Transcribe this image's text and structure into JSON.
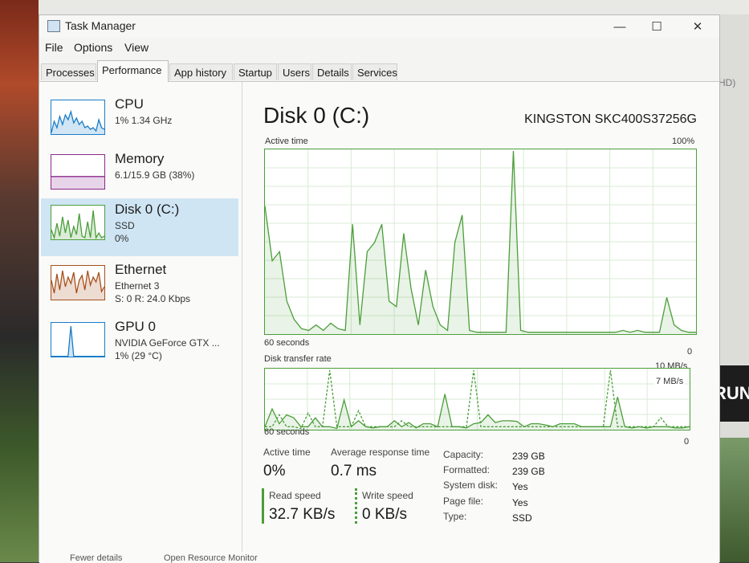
{
  "window": {
    "title": "Task Manager",
    "controls": {
      "minimize": "—",
      "maximize": "☐",
      "close": "✕"
    }
  },
  "menu": [
    "File",
    "Options",
    "View"
  ],
  "tabs": [
    {
      "label": "Processes",
      "active": false
    },
    {
      "label": "Performance",
      "active": true
    },
    {
      "label": "App history",
      "active": false
    },
    {
      "label": "Startup",
      "active": false
    },
    {
      "label": "Users",
      "active": false
    },
    {
      "label": "Details",
      "active": false
    },
    {
      "label": "Services",
      "active": false
    }
  ],
  "sidebar": [
    {
      "name": "CPU",
      "lines": [
        "1% 1.34 GHz"
      ],
      "color": "#1a7cc8",
      "selected": false,
      "spark": [
        5,
        40,
        20,
        55,
        30,
        60,
        45,
        70,
        35,
        50,
        30,
        40,
        20,
        25,
        15,
        20,
        10,
        45,
        20,
        15
      ]
    },
    {
      "name": "Memory",
      "lines": [
        "6.1/15.9 GB (38%)"
      ],
      "color": "#8b2a8b",
      "selected": false,
      "spark": [
        38,
        38,
        38,
        38,
        38,
        38,
        38,
        38,
        38,
        38,
        38,
        38,
        38,
        38,
        38,
        38,
        38,
        38,
        38,
        38
      ]
    },
    {
      "name": "Disk 0 (C:)",
      "lines": [
        "SSD",
        "0%"
      ],
      "color": "#4b9e3a",
      "selected": true,
      "spark": [
        30,
        5,
        50,
        10,
        70,
        20,
        60,
        5,
        40,
        15,
        80,
        10,
        5,
        55,
        5,
        90,
        5,
        20,
        5,
        10
      ]
    },
    {
      "name": "Ethernet",
      "lines": [
        "Ethernet 3",
        "S: 0 R: 24.0 Kbps"
      ],
      "color": "#a7501c",
      "selected": false,
      "spark": [
        60,
        20,
        80,
        30,
        90,
        40,
        70,
        50,
        85,
        20,
        60,
        75,
        30,
        90,
        45,
        70,
        55,
        85,
        25,
        40
      ]
    },
    {
      "name": "GPU 0",
      "lines": [
        "NVIDIA GeForce GTX ...",
        "1% (29 °C)"
      ],
      "color": "#1a7cc8",
      "selected": false,
      "spark": [
        1,
        1,
        1,
        1,
        1,
        1,
        1,
        95,
        1,
        1,
        1,
        1,
        1,
        1,
        1,
        1,
        1,
        1,
        1,
        1
      ]
    }
  ],
  "detail": {
    "title": "Disk 0 (C:)",
    "model": "KINGSTON SKC400S37256G",
    "active_time_graph": {
      "label": "Active time",
      "max_label": "100%",
      "time_label": "60 seconds",
      "min_label": "0",
      "series_color": "#4b9e3a",
      "values": [
        70,
        40,
        45,
        18,
        8,
        3,
        2,
        5,
        2,
        6,
        3,
        2,
        60,
        5,
        45,
        50,
        60,
        18,
        15,
        55,
        25,
        5,
        35,
        15,
        5,
        2,
        50,
        65,
        2,
        1,
        1,
        1,
        1,
        1,
        100,
        2,
        1,
        1,
        1,
        1,
        1,
        1,
        1,
        1,
        1,
        1,
        1,
        1,
        1,
        2,
        1,
        2,
        1,
        1,
        1,
        20,
        5,
        2,
        1,
        1
      ]
    },
    "transfer_graph": {
      "label": "Disk transfer rate",
      "max_label": "10 MB/s",
      "scale_label": "7 MB/s",
      "time_label": "60 seconds",
      "min_label": "0",
      "read_values": [
        0.5,
        3.5,
        1,
        2.5,
        2,
        0.5,
        0.5,
        2,
        0.5,
        0.5,
        0.2,
        5,
        0.5,
        1.5,
        0.5,
        0.3,
        0.5,
        0.5,
        1.5,
        0.5,
        1.2,
        0.3,
        1,
        1,
        0.5,
        6,
        0.5,
        0.5,
        0.3,
        1,
        1.2,
        2.5,
        1.2,
        1.5,
        1.5,
        1.4,
        0.5,
        1,
        1,
        0.8,
        0.5,
        1,
        1,
        1,
        0.5,
        0.5,
        0.5,
        0.5,
        0.5,
        5.5,
        0.5,
        0.3,
        0.5,
        0.3,
        0.5,
        0.5,
        0.5,
        0.3,
        0.3,
        0.5
      ],
      "write_values": [
        0.5,
        0.5,
        2.5,
        0.5,
        0.5,
        0.2,
        2.8,
        0.5,
        0.5,
        10,
        0.5,
        0.5,
        0.5,
        3.2,
        0.5,
        0.5,
        0.5,
        0.5,
        0.5,
        1.5,
        0.5,
        0.5,
        0.5,
        0.5,
        0.5,
        0.5,
        0.5,
        0.5,
        0.5,
        10,
        0.5,
        0.5,
        0.5,
        0.5,
        0.5,
        0.5,
        0.5,
        0.5,
        0.5,
        0.5,
        0.5,
        0.5,
        0.5,
        0.5,
        0.5,
        0.5,
        0.5,
        0.5,
        10,
        0.5,
        0.5,
        0.5,
        0.5,
        0.5,
        0.5,
        2,
        0.5,
        0.5,
        0.5,
        0.5
      ]
    },
    "stats": {
      "active_time": {
        "label": "Active time",
        "value": "0%"
      },
      "avg_response": {
        "label": "Average response time",
        "value": "0.7 ms"
      },
      "read_speed": {
        "label": "Read speed",
        "value": "32.7 KB/s"
      },
      "write_speed": {
        "label": "Write speed",
        "value": "0 KB/s"
      }
    },
    "properties": [
      {
        "key": "Capacity:",
        "value": "239 GB"
      },
      {
        "key": "Formatted:",
        "value": "239 GB"
      },
      {
        "key": "System disk:",
        "value": "Yes"
      },
      {
        "key": "Page file:",
        "value": "Yes"
      },
      {
        "key": "Type:",
        "value": "SSD"
      }
    ]
  },
  "footer": {
    "fewer_details": "Fewer details",
    "open_monitor": "Open Resource Monitor"
  },
  "background": {
    "right_text": "RUN",
    "right_hd": "HD)"
  }
}
